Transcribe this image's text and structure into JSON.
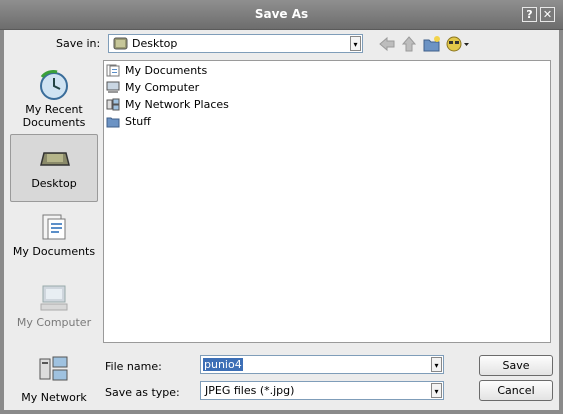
{
  "window": {
    "title": "Save As",
    "help_glyph": "?",
    "close_glyph": "✕"
  },
  "toolbar": {
    "save_in_label": "Save in:",
    "save_in_value": "Desktop",
    "icons": [
      "back-icon",
      "up-folder-icon",
      "new-folder-icon",
      "views-menu-icon"
    ]
  },
  "places": [
    {
      "label": "My Recent Documents",
      "icon": "recent-documents-icon"
    },
    {
      "label": "Desktop",
      "icon": "desktop-icon",
      "selected": true
    },
    {
      "label": "My Documents",
      "icon": "my-documents-icon"
    },
    {
      "label": "My Computer",
      "icon": "my-computer-icon"
    },
    {
      "label": "My Network",
      "icon": "my-network-icon"
    }
  ],
  "files": [
    {
      "name": "My Documents",
      "icon": "my-documents-icon"
    },
    {
      "name": "My Computer",
      "icon": "my-computer-icon"
    },
    {
      "name": "My Network Places",
      "icon": "network-places-icon"
    },
    {
      "name": "Stuff",
      "icon": "folder-icon"
    }
  ],
  "form": {
    "file_name_label": "File name:",
    "file_name_value": "punio4",
    "save_as_type_label": "Save as type:",
    "save_as_type_value": "JPEG files (*.jpg)"
  },
  "buttons": {
    "save": "Save",
    "cancel": "Cancel"
  },
  "colors": {
    "title_bar": "#7a7a7a",
    "dialog_bg": "#ececec",
    "selection": "#3d6fb6"
  }
}
